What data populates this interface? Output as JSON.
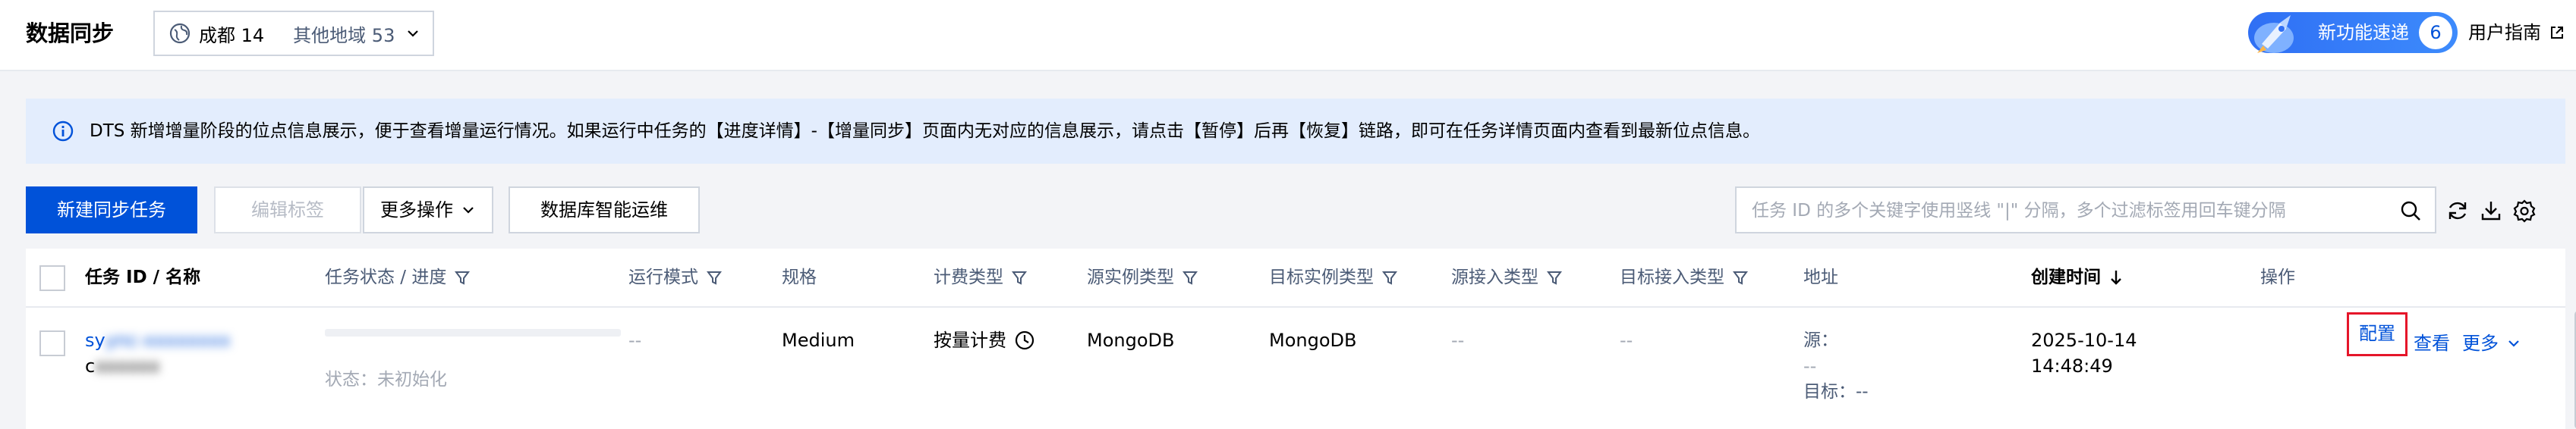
{
  "header": {
    "title": "数据同步",
    "region": {
      "current": "成都 14",
      "other": "其他地域 53"
    },
    "feature": {
      "label": "新功能速递",
      "badge": "6"
    },
    "guide": "用户指南"
  },
  "notice": {
    "text": "DTS 新增增量阶段的位点信息展示，便于查看增量运行情况。如果运行中任务的【进度详情】-【增量同步】页面内无对应的信息展示，请点击【暂停】后再【恢复】链路，即可在任务详情页面内查看到最新位点信息。"
  },
  "toolbar": {
    "create": "新建同步任务",
    "edit_tags": "编辑标签",
    "more": "更多操作",
    "db_ops": "数据库智能运维",
    "search_placeholder": "任务 ID 的多个关键字使用竖线 \"|\" 分隔，多个过滤标签用回车键分隔"
  },
  "table": {
    "columns": [
      "任务 ID / 名称",
      "任务状态 / 进度",
      "运行模式",
      "规格",
      "计费类型",
      "源实例类型",
      "目标实例类型",
      "源接入类型",
      "目标接入类型",
      "地址",
      "创建时间",
      "操作"
    ],
    "rows": [
      {
        "id": "sy",
        "id_hidden": "ync-xxxxxxxx",
        "name": "c",
        "name_hidden": "xxxxxx",
        "status": "状态：未初始化",
        "mode": "--",
        "spec": "Medium",
        "billing": "按量计费",
        "src_type": "MongoDB",
        "dst_type": "MongoDB",
        "src_access": "--",
        "dst_access": "--",
        "addr_src_label": "源：",
        "addr_src": "--",
        "addr_dst": "目标：--",
        "created_date": "2025-10-14",
        "created_time": "14:48:49",
        "actions": {
          "config": "配置",
          "view": "查看",
          "more": "更多"
        }
      }
    ]
  },
  "colors": {
    "primary": "#0052d9",
    "highlight": "#e5162a",
    "notice_bg": "#e3edfd"
  }
}
